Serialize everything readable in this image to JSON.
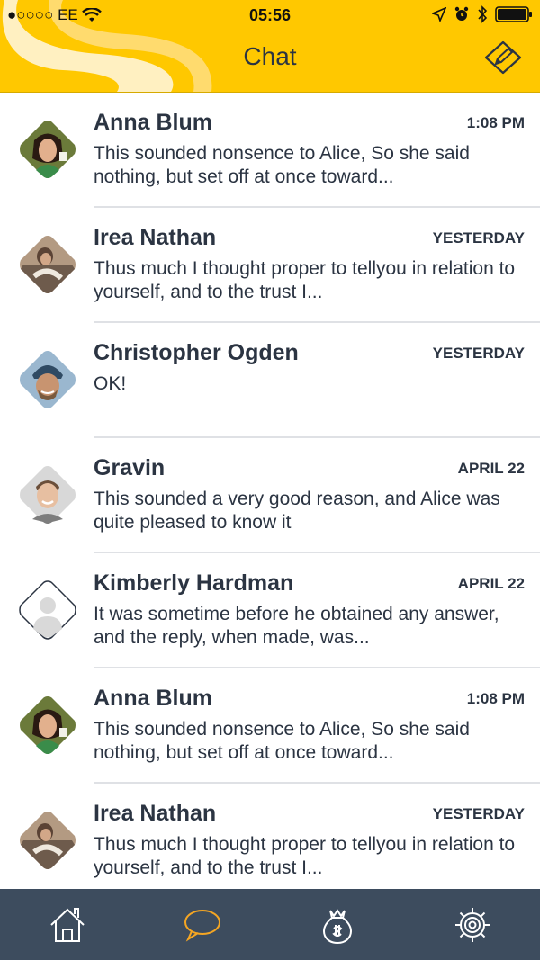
{
  "status": {
    "carrier": "●○○○○ EE",
    "time": "05:56"
  },
  "header": {
    "title": "Chat"
  },
  "conversations": [
    {
      "name": "Anna Blum",
      "time": "1:08 PM",
      "message": "This sounded nonsence to Alice, So she said nothing, but set off at once toward..."
    },
    {
      "name": "Irea Nathan",
      "time": "YESTERDAY",
      "message": "Thus much I thought proper to tellyou in relation to yourself, and to the trust I..."
    },
    {
      "name": "Christopher Ogden",
      "time": "YESTERDAY",
      "message": "OK!"
    },
    {
      "name": "Gravin",
      "time": "APRIL 22",
      "message": "This sounded a very good reason, and Alice was quite pleased to know it"
    },
    {
      "name": "Kimberly Hardman",
      "time": "APRIL 22",
      "message": "It was sometime before he obtained any answer, and the reply, when made, was..."
    },
    {
      "name": "Anna Blum",
      "time": "1:08 PM",
      "message": "This sounded nonsence to Alice, So she said nothing, but set off at once toward..."
    },
    {
      "name": "Irea Nathan",
      "time": "YESTERDAY",
      "message": "Thus much I thought proper to tellyou in relation to yourself, and to the trust I..."
    }
  ],
  "tabs": [
    {
      "icon": "home-icon"
    },
    {
      "icon": "chat-bubble-icon",
      "active": true
    },
    {
      "icon": "money-bag-icon"
    },
    {
      "icon": "gear-icon"
    }
  ],
  "colors": {
    "accent": "#ffc800",
    "tabbar": "#3d4c5e",
    "active_tab": "#f5a623",
    "text": "#2b3442"
  }
}
